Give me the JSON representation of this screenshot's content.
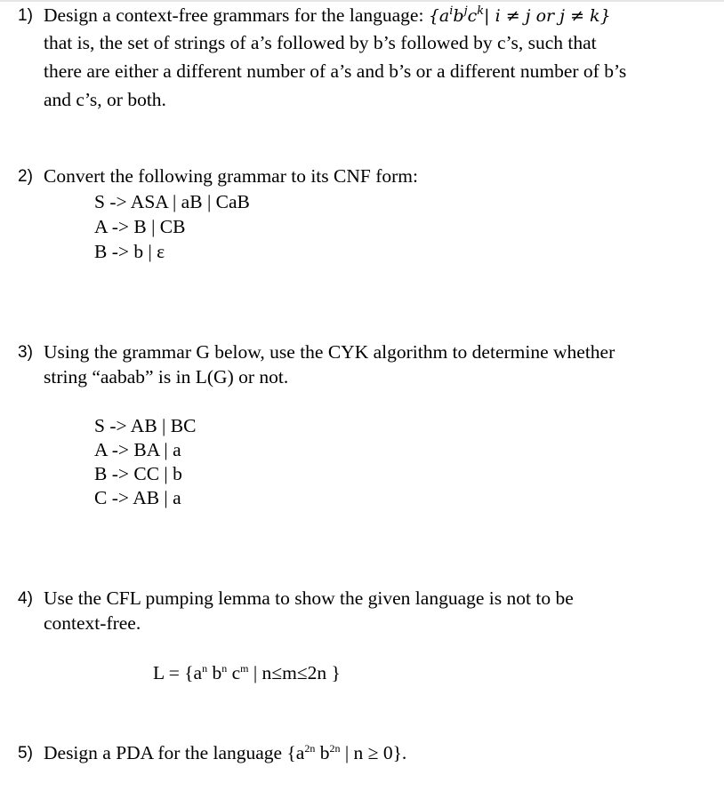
{
  "questions": [
    {
      "number": "1)",
      "lines": [
        "Design a context-free grammars for the language:",
        "that is, the set of strings of a’s followed by b’s followed by c’s, such that",
        "there are either a different number of a’s and b’s or a different number of b’s",
        "and c’s, or both."
      ],
      "math": {
        "open": "{",
        "a": "a",
        "a_exp": "i",
        "b": "b",
        "b_exp": "j",
        "c": "c",
        "c_exp": "k",
        "condition": "| i ≠ j or j ≠ k",
        "close": "}"
      }
    },
    {
      "number": "2)",
      "lines": [
        "Convert the following grammar to its CNF form:"
      ],
      "grammar": [
        "S -> ASA | aB | CaB",
        "A -> B | CB",
        "B -> b | ε"
      ]
    },
    {
      "number": "3)",
      "lines": [
        "Using the grammar G below, use the CYK algorithm to determine whether",
        "string “aabab” is in L(G) or not."
      ],
      "grammar": [
        "S -> AB | BC",
        "A -> BA | a",
        "B -> CC | b",
        "C -> AB | a"
      ]
    },
    {
      "number": "4)",
      "lines": [
        "Use the CFL pumping lemma to show the given language is not to be",
        "context-free."
      ],
      "language": {
        "prefix": "L = {a",
        "a_exp": "n",
        "b": " b",
        "b_exp": "n",
        "c": " c",
        "c_exp": "m",
        "suffix": " | n≤m≤2n }"
      }
    },
    {
      "number": "5)",
      "lines": [
        "Design a PDA for the language"
      ],
      "language": {
        "prefix": " {a",
        "a_exp": "2n",
        "b": " b",
        "b_exp": "2n",
        "suffix": " | n ≥ 0}."
      }
    }
  ]
}
